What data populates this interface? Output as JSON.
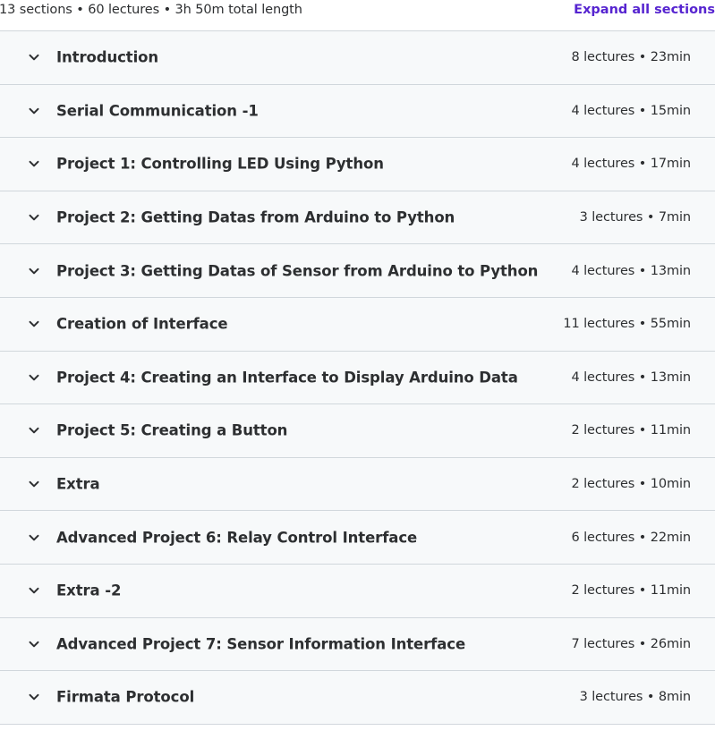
{
  "summary": {
    "text": "13 sections • 60 lectures • 3h 50m total length",
    "expand_label": "Expand all sections"
  },
  "colors": {
    "accent": "#5624d0",
    "row_background": "#f7f9fa",
    "border": "#d1d7dc",
    "text": "#2d2f31"
  },
  "sections": [
    {
      "title": "Introduction",
      "meta": "8 lectures • 23min",
      "icon": "chevron-down-icon"
    },
    {
      "title": "Serial Communication -1",
      "meta": "4 lectures • 15min",
      "icon": "chevron-down-icon"
    },
    {
      "title": "Project 1: Controlling LED Using Python",
      "meta": "4 lectures • 17min",
      "icon": "chevron-down-icon"
    },
    {
      "title": "Project 2: Getting Datas from Arduino to Python",
      "meta": "3 lectures • 7min",
      "icon": "chevron-down-icon"
    },
    {
      "title": "Project 3: Getting Datas of Sensor from Arduino to Python",
      "meta": "4 lectures • 13min",
      "icon": "chevron-down-icon"
    },
    {
      "title": "Creation of Interface",
      "meta": "11 lectures • 55min",
      "icon": "chevron-down-icon"
    },
    {
      "title": "Project 4: Creating an Interface to Display Arduino Data",
      "meta": "4 lectures • 13min",
      "icon": "chevron-down-icon"
    },
    {
      "title": "Project 5: Creating a Button",
      "meta": "2 lectures • 11min",
      "icon": "chevron-down-icon"
    },
    {
      "title": "Extra",
      "meta": "2 lectures • 10min",
      "icon": "chevron-down-icon"
    },
    {
      "title": "Advanced Project 6: Relay Control Interface",
      "meta": "6 lectures • 22min",
      "icon": "chevron-down-icon"
    },
    {
      "title": "Extra -2",
      "meta": "2 lectures • 11min",
      "icon": "chevron-down-icon"
    },
    {
      "title": "Advanced Project 7: Sensor Information Interface",
      "meta": "7 lectures • 26min",
      "icon": "chevron-down-icon"
    },
    {
      "title": "Firmata Protocol",
      "meta": "3 lectures • 8min",
      "icon": "chevron-down-icon"
    }
  ]
}
